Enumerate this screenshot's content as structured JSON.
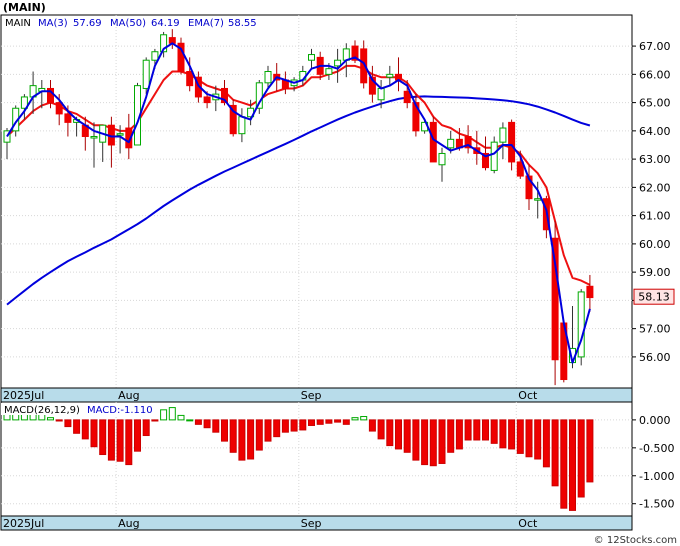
{
  "chart_data": {
    "type": "candlestick",
    "symbol": "MAIN",
    "legend": {
      "symbol_label": "(MAIN)",
      "main": "MAIN",
      "ma3": {
        "label": "MA(3)",
        "value": "57.69",
        "color": "#0000cc"
      },
      "ma50": {
        "label": "MA(50)",
        "value": "64.19",
        "color": "#0000cc"
      },
      "ema7": {
        "label": "EMA(7)",
        "value": "58.55",
        "color": "#0000cc"
      }
    },
    "price_panel": {
      "ylim": [
        54.9,
        68.1
      ],
      "yticks": [
        56,
        57,
        58,
        59,
        60,
        61,
        62,
        63,
        64,
        65,
        66,
        67
      ],
      "ytick_labels": [
        "56.00",
        "57.00",
        "58.00",
        "59.00",
        "60.00",
        "61.00",
        "62.00",
        "63.00",
        "64.00",
        "65.00",
        "66.00",
        "67.00"
      ],
      "last_price_label": "58.13",
      "last_price": 58.13
    },
    "month_labels": [
      {
        "label": "2025Jul",
        "index": 0
      },
      {
        "label": "Aug",
        "index": 13
      },
      {
        "label": "Sep",
        "index": 34
      },
      {
        "label": "Oct",
        "index": 59
      }
    ],
    "candles": [
      [
        63.6,
        64.1,
        63.0,
        64.0
      ],
      [
        64.0,
        64.9,
        63.8,
        64.8
      ],
      [
        64.8,
        65.3,
        64.4,
        65.2
      ],
      [
        65.2,
        66.1,
        64.6,
        65.6
      ],
      [
        65.4,
        65.8,
        64.8,
        65.5
      ],
      [
        65.5,
        65.8,
        64.8,
        65.0
      ],
      [
        65.0,
        65.3,
        64.2,
        64.6
      ],
      [
        64.6,
        64.9,
        63.8,
        64.3
      ],
      [
        64.3,
        64.5,
        63.8,
        64.4
      ],
      [
        64.2,
        64.5,
        63.3,
        63.8
      ],
      [
        63.8,
        64.3,
        62.7,
        63.8
      ],
      [
        63.6,
        64.0,
        62.9,
        64.2
      ],
      [
        64.2,
        64.5,
        62.7,
        63.5
      ],
      [
        63.9,
        64.2,
        63.2,
        63.9
      ],
      [
        64.1,
        64.6,
        63.0,
        63.4
      ],
      [
        63.5,
        65.7,
        63.5,
        65.6
      ],
      [
        65.5,
        66.6,
        65.3,
        66.5
      ],
      [
        66.5,
        66.9,
        66.2,
        66.8
      ],
      [
        66.8,
        67.5,
        66.6,
        67.4
      ],
      [
        67.3,
        67.6,
        66.9,
        67.1
      ],
      [
        67.1,
        67.3,
        66.0,
        66.1
      ],
      [
        66.1,
        66.6,
        65.4,
        65.6
      ],
      [
        65.9,
        66.1,
        65.0,
        65.2
      ],
      [
        65.2,
        65.4,
        64.8,
        65.0
      ],
      [
        65.1,
        65.6,
        64.7,
        65.3
      ],
      [
        65.5,
        65.8,
        64.9,
        65.0
      ],
      [
        64.9,
        65.1,
        63.8,
        63.9
      ],
      [
        63.9,
        64.8,
        63.6,
        64.5
      ],
      [
        64.5,
        65.1,
        64.2,
        64.8
      ],
      [
        64.8,
        65.8,
        64.6,
        65.7
      ],
      [
        65.7,
        66.3,
        65.5,
        66.1
      ],
      [
        66.0,
        66.4,
        65.4,
        65.8
      ],
      [
        65.8,
        66.1,
        65.3,
        65.5
      ],
      [
        65.6,
        65.9,
        65.4,
        65.8
      ],
      [
        65.8,
        66.3,
        65.6,
        66.1
      ],
      [
        66.5,
        66.9,
        66.2,
        66.7
      ],
      [
        66.6,
        66.8,
        65.8,
        66.0
      ],
      [
        66.0,
        66.4,
        65.8,
        66.2
      ],
      [
        66.3,
        66.9,
        65.7,
        66.5
      ],
      [
        66.5,
        67.1,
        65.9,
        66.9
      ],
      [
        67.0,
        67.2,
        66.4,
        66.5
      ],
      [
        66.9,
        67.2,
        65.5,
        65.7
      ],
      [
        65.9,
        66.3,
        65.0,
        65.3
      ],
      [
        65.1,
        65.8,
        64.8,
        65.5
      ],
      [
        65.9,
        66.3,
        65.6,
        66.0
      ],
      [
        66.0,
        66.6,
        65.4,
        65.8
      ],
      [
        65.4,
        65.8,
        64.8,
        65.0
      ],
      [
        65.0,
        65.3,
        63.8,
        64.0
      ],
      [
        64.0,
        64.4,
        63.9,
        64.3
      ],
      [
        64.3,
        64.5,
        62.9,
        62.9
      ],
      [
        62.8,
        63.4,
        62.2,
        63.2
      ],
      [
        63.4,
        64.0,
        63.2,
        63.7
      ],
      [
        63.7,
        64.1,
        63.3,
        63.4
      ],
      [
        63.8,
        64.2,
        63.2,
        63.4
      ],
      [
        63.4,
        64.0,
        62.8,
        63.2
      ],
      [
        63.2,
        63.8,
        62.6,
        62.7
      ],
      [
        62.6,
        63.8,
        62.5,
        63.6
      ],
      [
        63.6,
        64.3,
        63.0,
        64.1
      ],
      [
        64.3,
        64.4,
        62.6,
        62.9
      ],
      [
        62.9,
        63.3,
        62.3,
        62.4
      ],
      [
        62.4,
        62.8,
        61.2,
        61.6
      ],
      [
        61.6,
        62.2,
        60.9,
        61.6
      ],
      [
        61.6,
        61.7,
        60.2,
        60.5
      ],
      [
        60.2,
        60.8,
        55.0,
        55.9
      ],
      [
        57.2,
        57.3,
        55.1,
        55.2
      ],
      [
        55.8,
        57.8,
        55.6,
        56.3
      ],
      [
        56.0,
        58.4,
        55.7,
        58.3
      ],
      [
        58.5,
        58.9,
        57.6,
        58.1
      ]
    ],
    "indicators": {
      "ma3": [
        63.8,
        64.3,
        64.7,
        65.2,
        65.4,
        65.4,
        65.1,
        64.7,
        64.4,
        64.2,
        64.0,
        63.9,
        63.8,
        63.8,
        63.6,
        64.3,
        65.2,
        66.3,
        66.9,
        67.1,
        66.9,
        66.3,
        65.6,
        65.3,
        65.2,
        65.1,
        64.7,
        64.5,
        64.4,
        65.0,
        65.5,
        65.9,
        65.8,
        65.7,
        65.8,
        66.2,
        66.3,
        66.3,
        66.2,
        66.5,
        66.6,
        66.4,
        65.8,
        65.5,
        65.6,
        65.8,
        65.6,
        64.9,
        64.4,
        63.7,
        63.5,
        63.3,
        63.4,
        63.5,
        63.3,
        63.1,
        63.2,
        63.5,
        63.5,
        63.1,
        62.3,
        61.9,
        61.2,
        59.3,
        57.2,
        55.8,
        56.6,
        57.7
      ],
      "ma50": [
        57.85,
        58.1,
        58.34,
        58.58,
        58.8,
        59.0,
        59.2,
        59.39,
        59.55,
        59.7,
        59.86,
        60.01,
        60.16,
        60.34,
        60.52,
        60.7,
        60.9,
        61.12,
        61.34,
        61.54,
        61.73,
        61.92,
        62.09,
        62.25,
        62.41,
        62.56,
        62.7,
        62.84,
        62.98,
        63.12,
        63.26,
        63.4,
        63.54,
        63.68,
        63.83,
        63.98,
        64.12,
        64.26,
        64.4,
        64.53,
        64.65,
        64.76,
        64.86,
        64.96,
        65.05,
        65.13,
        65.18,
        65.21,
        65.22,
        65.21,
        65.2,
        65.19,
        65.18,
        65.17,
        65.15,
        65.13,
        65.11,
        65.08,
        65.05,
        65.0,
        64.94,
        64.86,
        64.76,
        64.65,
        64.53,
        64.4,
        64.28,
        64.19
      ],
      "ema7": [
        63.8,
        64.1,
        64.4,
        64.7,
        64.9,
        65.0,
        64.9,
        64.7,
        64.6,
        64.4,
        64.2,
        64.2,
        64.1,
        64.0,
        64.0,
        64.3,
        64.8,
        65.3,
        65.8,
        66.1,
        66.1,
        66.0,
        65.8,
        65.6,
        65.5,
        65.4,
        65.1,
        65.0,
        64.9,
        65.1,
        65.3,
        65.4,
        65.5,
        65.5,
        65.6,
        65.9,
        65.9,
        66.0,
        66.1,
        66.3,
        66.3,
        66.2,
        66.0,
        65.9,
        65.9,
        65.9,
        65.7,
        65.3,
        65.0,
        64.5,
        64.2,
        64.1,
        63.9,
        63.8,
        63.6,
        63.4,
        63.4,
        63.5,
        63.4,
        63.2,
        62.8,
        62.5,
        62.0,
        60.8,
        59.6,
        58.8,
        58.7,
        58.55
      ]
    },
    "macd_panel": {
      "label": "MACD(26,12,9)",
      "value_label": "MACD:-1.110",
      "ylim": [
        -1.72,
        0.32
      ],
      "yticks": [
        0,
        -0.5,
        -1.0,
        -1.5
      ],
      "ytick_labels": [
        "0.000",
        "-0.500",
        "-1.000",
        "-1.500"
      ],
      "values": [
        0.28,
        0.28,
        0.26,
        0.26,
        0.22,
        0.04,
        -0.02,
        -0.12,
        -0.24,
        -0.34,
        -0.48,
        -0.62,
        -0.72,
        -0.74,
        -0.8,
        -0.56,
        -0.28,
        -0.02,
        0.18,
        0.22,
        0.08,
        0.0,
        -0.08,
        -0.14,
        -0.22,
        -0.38,
        -0.58,
        -0.72,
        -0.7,
        -0.54,
        -0.38,
        -0.3,
        -0.22,
        -0.2,
        -0.18,
        -0.1,
        -0.08,
        -0.06,
        -0.04,
        -0.08,
        0.04,
        0.06,
        -0.2,
        -0.34,
        -0.46,
        -0.52,
        -0.58,
        -0.72,
        -0.8,
        -0.82,
        -0.78,
        -0.58,
        -0.52,
        -0.36,
        -0.36,
        -0.36,
        -0.42,
        -0.5,
        -0.52,
        -0.6,
        -0.66,
        -0.7,
        -0.84,
        -1.18,
        -1.58,
        -1.62,
        -1.38,
        -1.11
      ]
    }
  },
  "watermark": "© 12Stocks.com",
  "colors": {
    "up": "#00aa00",
    "down": "#ee0000",
    "ma": "#0000dd",
    "ema": "#ee1111",
    "axis_band": "#b8dcea",
    "price_box_bg": "#ffe4e4",
    "price_box_border": "#cc0000"
  }
}
